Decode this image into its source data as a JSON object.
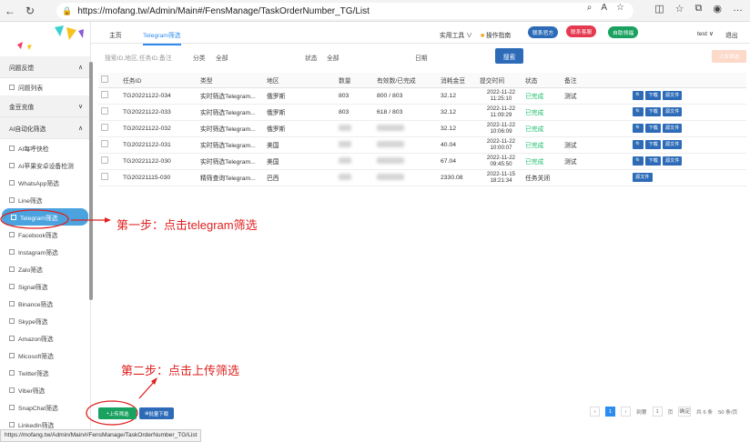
{
  "browser": {
    "url": "https://mofang.tw/Admin/Main#/FensManage/TaskOrderNumber_TG/List",
    "status_url": "https://mofang.tw/Admin/Main#/FensManage/TaskOrderNumber_TG/List"
  },
  "sidebar": {
    "groups": [
      {
        "label": "问题反馈",
        "items": [
          "问题列表"
        ]
      },
      {
        "label": "金豆充值",
        "items": []
      },
      {
        "label": "AI自动化筛选",
        "items": [
          "AI每呼快检",
          "AI苹果安卓设备检测",
          "WhatsApp筛选",
          "Line筛选",
          "Telegram筛选",
          "Facebook筛选",
          "Instagram筛选",
          "Zalo筛选",
          "Signal筛选",
          "Binance筛选",
          "Skype筛选",
          "Amazon筛选",
          "Micosoft筛选",
          "Twitter筛选",
          "Viber筛选",
          "SnapChat筛选",
          "LinkedIn筛选"
        ]
      }
    ]
  },
  "topnav": {
    "tab_home": "主页",
    "tab_telegram": "Telegram筛选",
    "tools": "实用工具",
    "guide": "操作指南",
    "contact1": "联系官方",
    "contact2": "联系客服",
    "auto_get": "自助领福",
    "user": "test",
    "logout": "退出"
  },
  "filter": {
    "search_placeholder": "搜索ID,地区,任务ID,备注",
    "category_label": "分类",
    "category_value": "全部",
    "status_label": "状态",
    "status_value": "全部",
    "date_label": "日期",
    "search_button": "搜索",
    "upload_button": "上传筛选"
  },
  "table": {
    "headers": [
      "任务ID",
      "类型",
      "地区",
      "数量",
      "有效数/已完成",
      "消耗金豆",
      "提交时间",
      "状态",
      "备注"
    ],
    "rows": [
      {
        "id": "TG20221122-034",
        "type": "实时筛选Telegram...",
        "region": "俄罗斯",
        "qty": "803",
        "valid": "800 / 803",
        "cost": "32.12",
        "time": "2022-11-22 11:25:10",
        "status": "已完成",
        "note": "测试",
        "actions": [
          "下载",
          "源文件"
        ]
      },
      {
        "id": "TG20221122-033",
        "type": "实时筛选Telegram...",
        "region": "俄罗斯",
        "qty": "803",
        "valid": "618 / 803",
        "cost": "32.12",
        "time": "2022-11-22 11:09:29",
        "status": "已完成",
        "note": "",
        "actions": [
          "下载",
          "源文件"
        ]
      },
      {
        "id": "TG20221122-032",
        "type": "实时筛选Telegram...",
        "region": "俄罗斯",
        "qty": "",
        "valid": "",
        "cost": "32.12",
        "time": "2022-11-22 10:06:09",
        "status": "已完成",
        "note": "",
        "actions": [
          "下载",
          "源文件"
        ]
      },
      {
        "id": "TG20221122-031",
        "type": "实时筛选Telegram...",
        "region": "美国",
        "qty": "",
        "valid": "",
        "cost": "40.04",
        "time": "2022-11-22 10:00:07",
        "status": "已完成",
        "note": "测试",
        "actions": [
          "下载",
          "源文件"
        ]
      },
      {
        "id": "TG20221122-030",
        "type": "实时筛选Telegram...",
        "region": "美国",
        "qty": "",
        "valid": "",
        "cost": "67.04",
        "time": "2022-11-22 09:45:50",
        "status": "已完成",
        "note": "测试",
        "actions": [
          "下载",
          "源文件"
        ]
      },
      {
        "id": "TG20221115-030",
        "type": "精筛查询Telegram...",
        "region": "巴西",
        "qty": "",
        "valid": "",
        "cost": "2330.08",
        "time": "2022-11-15 18:21:34",
        "status": "任务关闭",
        "note": "",
        "actions": [
          "源文件"
        ]
      }
    ]
  },
  "annotations": {
    "step1": "第一步：点击telegram筛选",
    "step2": "第二步：点击上传筛选"
  },
  "bottom": {
    "upload_button": "上传筛选",
    "batch_download": "批量下载"
  },
  "pager": {
    "current": "1",
    "goto_label": "到第",
    "goto_value": "1",
    "page_unit": "页",
    "confirm": "确定",
    "total": "共 6 条",
    "page_size": "50 条/页"
  }
}
